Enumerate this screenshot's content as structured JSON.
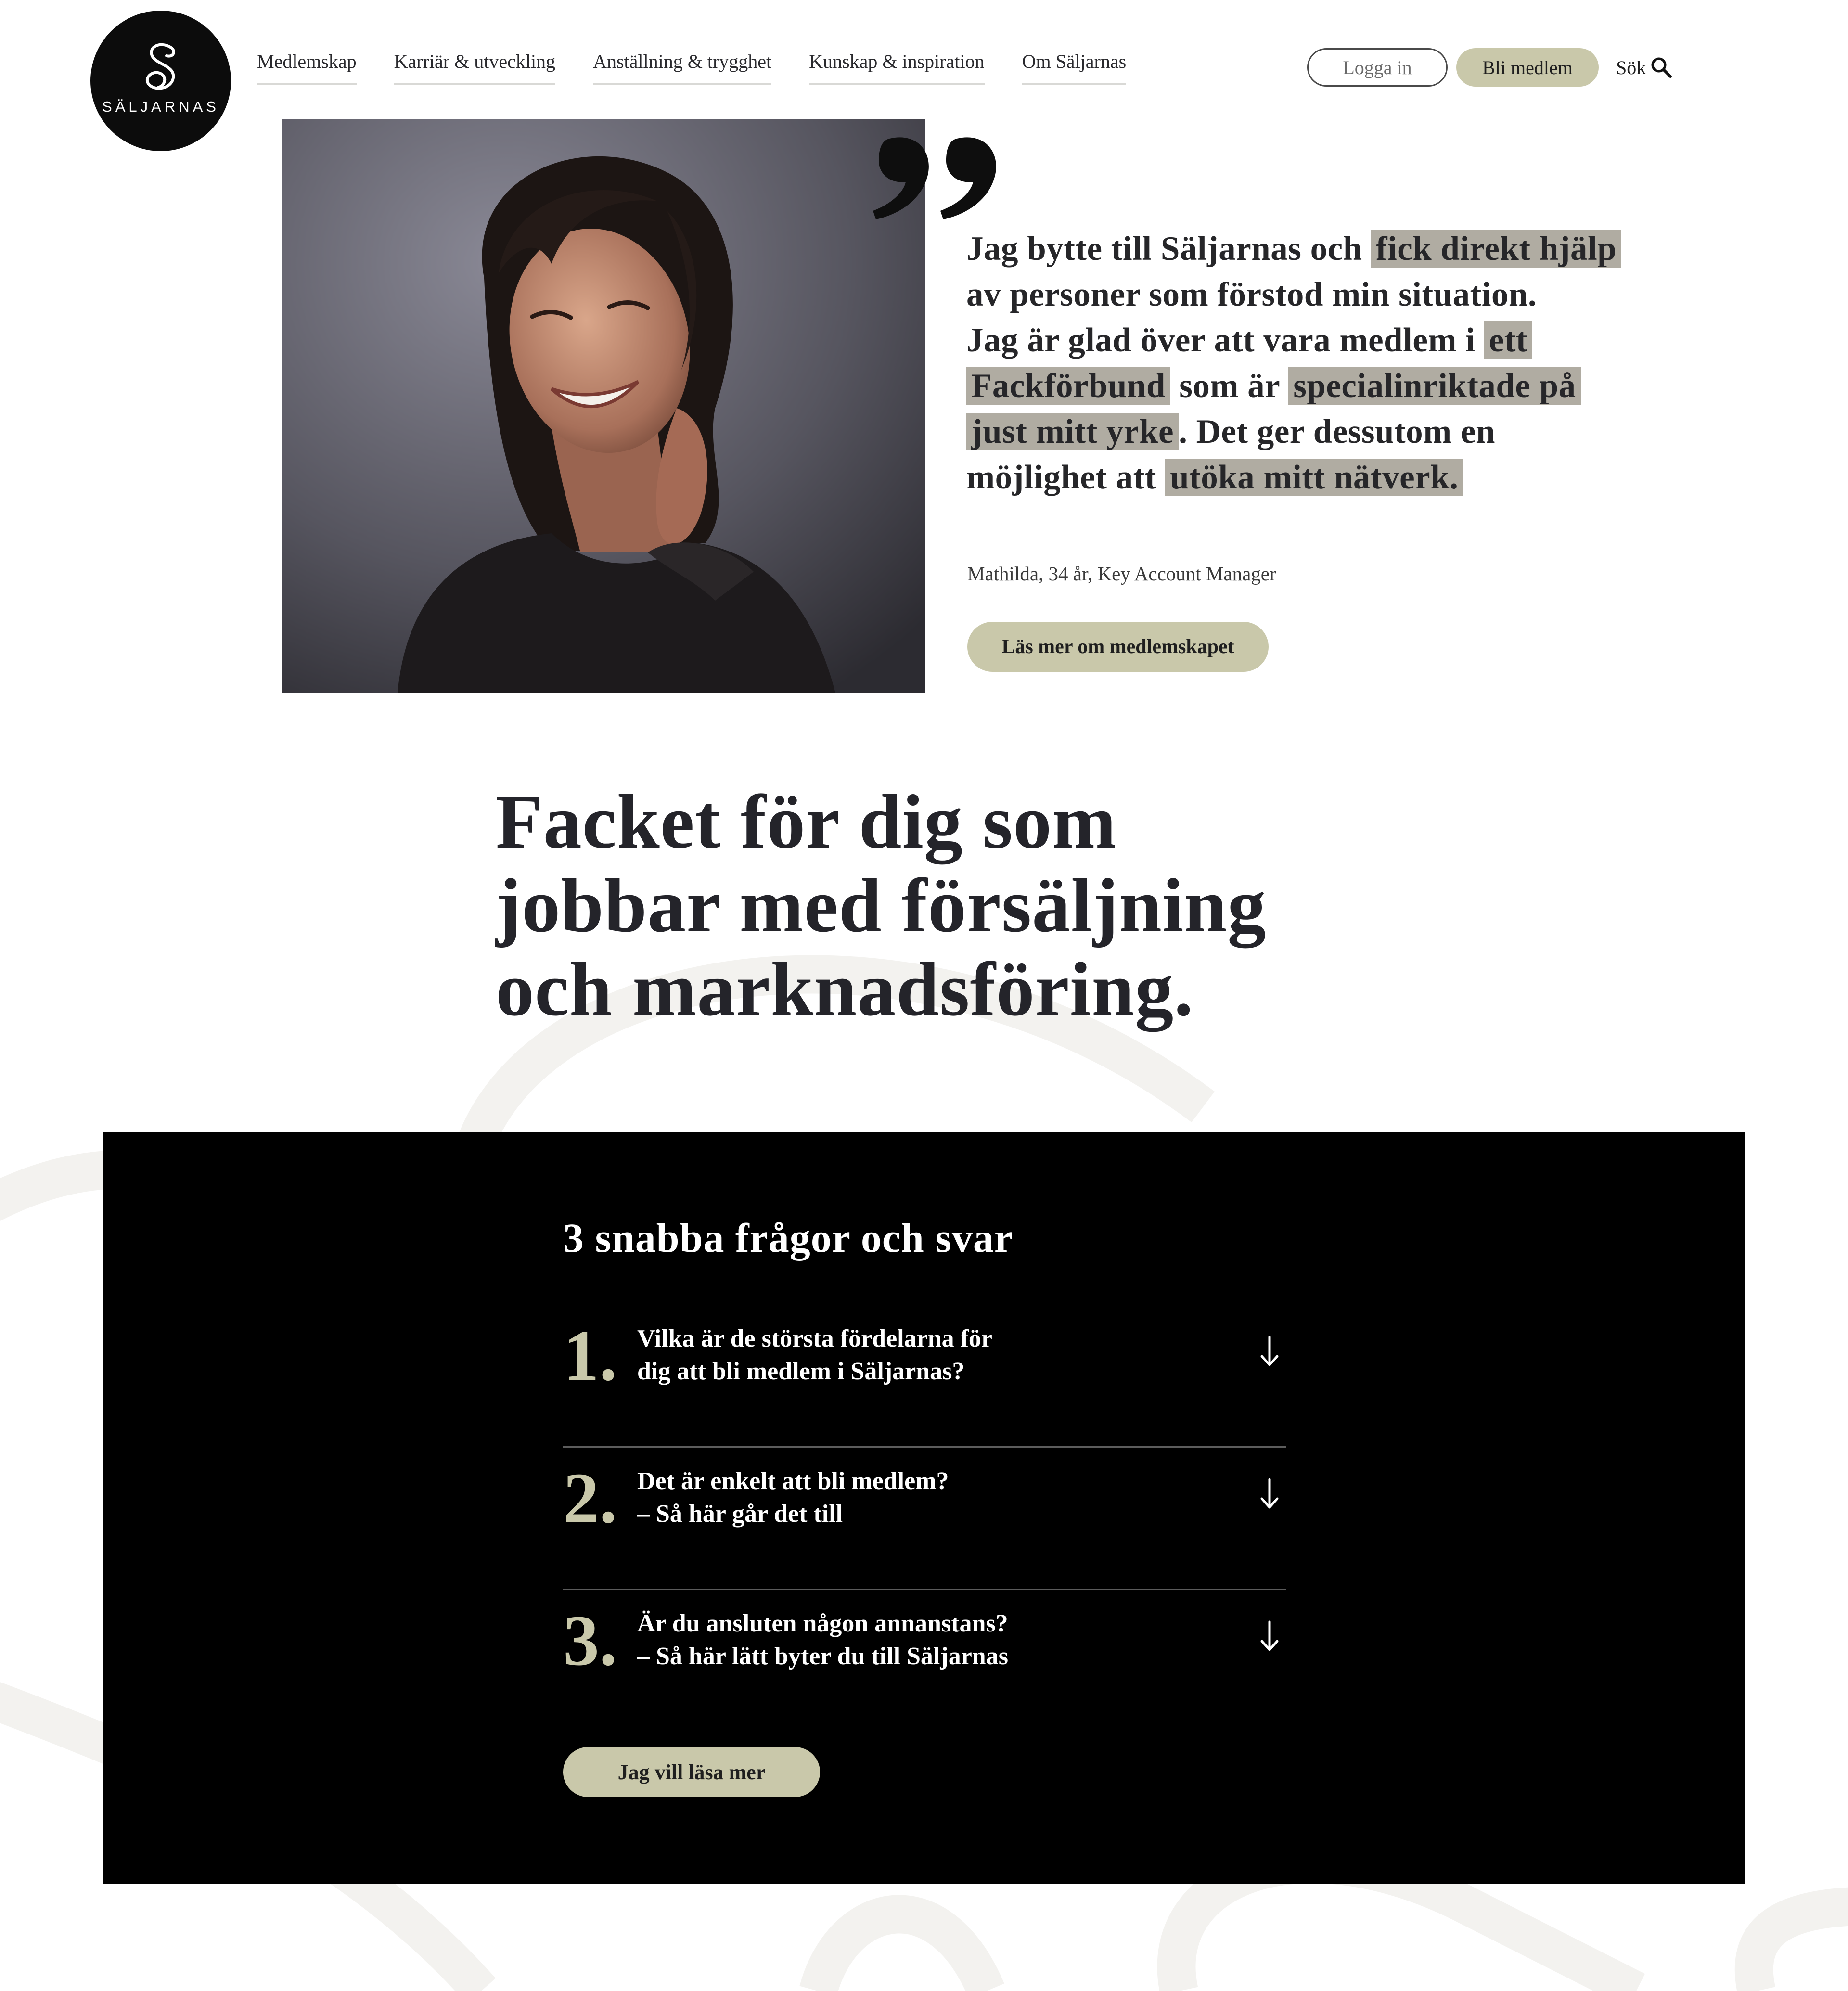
{
  "brand": {
    "name": "SÄLJARNAS"
  },
  "nav": {
    "items": [
      {
        "label": "Medlemskap"
      },
      {
        "label": "Karriär & utveckling"
      },
      {
        "label": "Anställning & trygghet"
      },
      {
        "label": "Kunskap & inspiration"
      },
      {
        "label": "Om Säljarnas"
      }
    ]
  },
  "header": {
    "login_label": "Logga in",
    "join_label": "Bli medlem",
    "search_label": "Sök"
  },
  "testimonial": {
    "segments": [
      "Jag bytte till Säljarnas och ",
      "fick direkt hjälp",
      " av personer som förstod min situation.",
      "Jag är glad över att vara medlem i ",
      "ett Fackförbund",
      " som är ",
      "specialinriktade på just mitt yrke",
      ". Det ger dessutom en möjlighet att ",
      "utöka mitt nätverk."
    ],
    "attribution": "Mathilda, 34 år, Key Account Manager",
    "cta_label": "Läs mer om medlemskapet"
  },
  "hero": {
    "line1": "Facket för dig som",
    "line2": "jobbar med försäljning",
    "line3": "och marknadsföring."
  },
  "faq": {
    "title": "3 snabba frågor och svar",
    "items": [
      {
        "number": "1.",
        "line1": "Vilka är de största fördelarna för",
        "line2": "dig att bli medlem i Säljarnas?"
      },
      {
        "number": "2.",
        "line1": "Det är enkelt att bli medlem?",
        "line2": "– Så här går det till"
      },
      {
        "number": "3.",
        "line1": "Är du ansluten någon annanstans?",
        "line2": "– Så här lätt byter du till Säljarnas"
      }
    ],
    "cta_label": "Jag vill läsa mer"
  },
  "colors": {
    "accent": "#c9c8aa",
    "highlight": "#b0aca2",
    "dark": "#000000",
    "text": "#262629"
  },
  "icons": {
    "search": "search-icon",
    "arrow": "arrow-down-icon",
    "quote": "quote-icon",
    "logo": "saljarnas-logo-icon"
  }
}
